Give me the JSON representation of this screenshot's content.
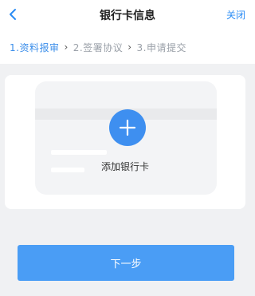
{
  "header": {
    "title": "银行卡信息",
    "close_label": "关闭",
    "back_icon": "chevron-left-icon"
  },
  "steps": [
    {
      "label": "1.资料报审",
      "active": true
    },
    {
      "label": "2.签署协议",
      "active": false
    },
    {
      "label": "3.申请提交",
      "active": false
    }
  ],
  "card": {
    "add_label": "添加银行卡",
    "add_icon": "plus-icon"
  },
  "footer": {
    "next_label": "下一步"
  },
  "colors": {
    "accent": "#3e8ff0",
    "button": "#4a9df5",
    "background": "#f0f1f3"
  }
}
